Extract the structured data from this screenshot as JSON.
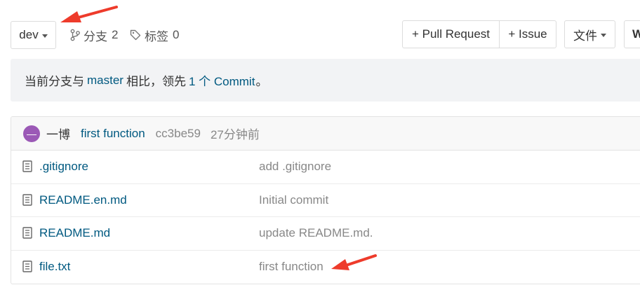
{
  "toolbar": {
    "branch": "dev",
    "branches_label": "分支",
    "branches_count": "2",
    "tags_label": "标签",
    "tags_count": "0",
    "pull_request_label": "+ Pull Request",
    "issue_label": "+ Issue",
    "file_menu_label": "文件",
    "web_ide_label": "W"
  },
  "banner": {
    "prefix": "当前分支与",
    "base_branch": "master",
    "middle": "相比，领先",
    "ahead_link": "1 个 Commit",
    "suffix": "。"
  },
  "latest_commit": {
    "avatar_initial": "—",
    "author": "一博",
    "message": "first function",
    "sha": "cc3be59",
    "time": "27分钟前"
  },
  "files": [
    {
      "name": ".gitignore",
      "commit": "add .gitignore"
    },
    {
      "name": "README.en.md",
      "commit": "Initial commit"
    },
    {
      "name": "README.md",
      "commit": "update README.md."
    },
    {
      "name": "file.txt",
      "commit": "first function"
    }
  ],
  "colors": {
    "link": "#005980",
    "muted": "#888888",
    "banner_bg": "#f2f3f5",
    "avatar": "#9b59b6",
    "annotation": "#ee3b2b"
  }
}
